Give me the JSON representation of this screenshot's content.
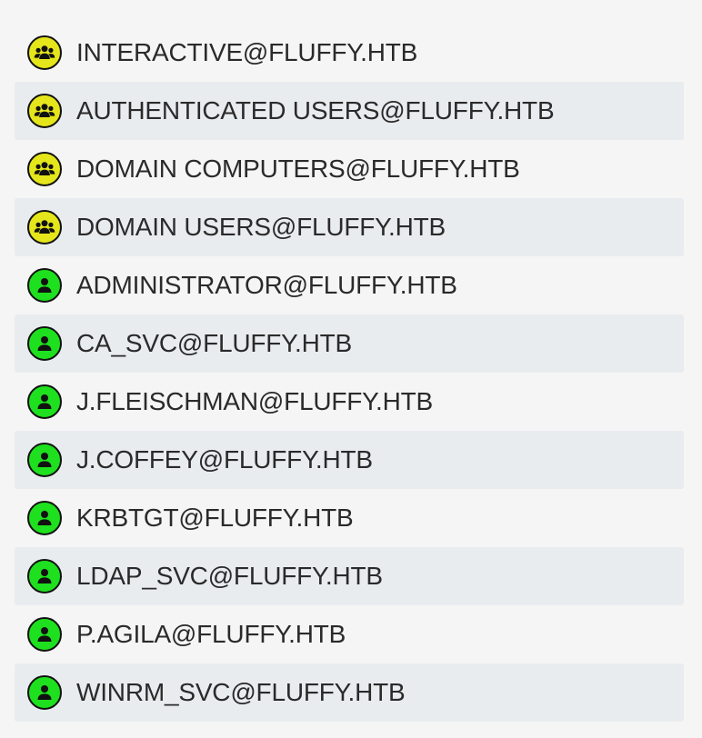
{
  "colors": {
    "group_icon_fill": "#e5e51b",
    "user_icon_fill": "#1ee01e",
    "icon_stroke": "#111111",
    "stripe": "#e9ecef",
    "background": "#f5f5f5",
    "text": "#2a2a2a"
  },
  "nodes": [
    {
      "label": "INTERACTIVE@FLUFFY.HTB",
      "kind": "group",
      "icon": "group-icon"
    },
    {
      "label": "AUTHENTICATED USERS@FLUFFY.HTB",
      "kind": "group",
      "icon": "group-icon"
    },
    {
      "label": "DOMAIN COMPUTERS@FLUFFY.HTB",
      "kind": "group",
      "icon": "group-icon"
    },
    {
      "label": "DOMAIN USERS@FLUFFY.HTB",
      "kind": "group",
      "icon": "group-icon"
    },
    {
      "label": "ADMINISTRATOR@FLUFFY.HTB",
      "kind": "user",
      "icon": "user-icon"
    },
    {
      "label": "CA_SVC@FLUFFY.HTB",
      "kind": "user",
      "icon": "user-icon"
    },
    {
      "label": "J.FLEISCHMAN@FLUFFY.HTB",
      "kind": "user",
      "icon": "user-icon"
    },
    {
      "label": "J.COFFEY@FLUFFY.HTB",
      "kind": "user",
      "icon": "user-icon"
    },
    {
      "label": "KRBTGT@FLUFFY.HTB",
      "kind": "user",
      "icon": "user-icon"
    },
    {
      "label": "LDAP_SVC@FLUFFY.HTB",
      "kind": "user",
      "icon": "user-icon"
    },
    {
      "label": "P.AGILA@FLUFFY.HTB",
      "kind": "user",
      "icon": "user-icon"
    },
    {
      "label": "WINRM_SVC@FLUFFY.HTB",
      "kind": "user",
      "icon": "user-icon"
    }
  ]
}
